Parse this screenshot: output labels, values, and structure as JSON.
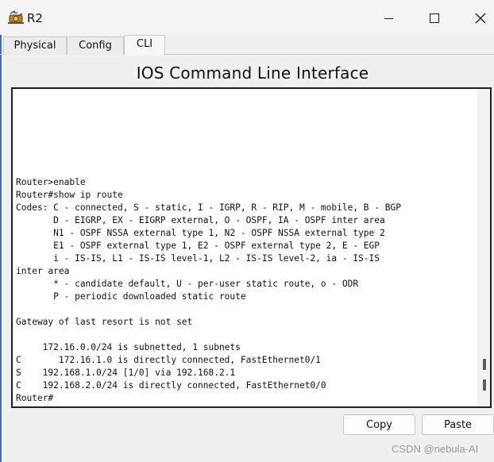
{
  "window": {
    "title": "R2",
    "icon": "router-icon"
  },
  "window_controls": {
    "minimize": "minimize-icon",
    "maximize": "maximize-icon",
    "close": "close-icon"
  },
  "tabs": [
    {
      "label": "Physical"
    },
    {
      "label": "Config"
    },
    {
      "label": "CLI"
    }
  ],
  "active_tab": "CLI",
  "heading": "IOS Command Line Interface",
  "terminal": {
    "lines": [
      "Router>enable",
      "Router#show ip route",
      "Codes: C - connected, S - static, I - IGRP, R - RIP, M - mobile, B - BGP",
      "       D - EIGRP, EX - EIGRP external, O - OSPF, IA - OSPF inter area",
      "       N1 - OSPF NSSA external type 1, N2 - OSPF NSSA external type 2",
      "       E1 - OSPF external type 1, E2 - OSPF external type 2, E - EGP",
      "       i - IS-IS, L1 - IS-IS level-1, L2 - IS-IS level-2, ia - IS-IS",
      "inter area",
      "       * - candidate default, U - per-user static route, o - ODR",
      "       P - periodic downloaded static route",
      "",
      "Gateway of last resort is not set",
      "",
      "     172.16.0.0/24 is subnetted, 1 subnets",
      "C       172.16.1.0 is directly connected, FastEthernet0/1",
      "S    192.168.1.0/24 [1/0] via 192.168.2.1",
      "C    192.168.2.0/24 is directly connected, FastEthernet0/0",
      "Router#"
    ]
  },
  "buttons": {
    "copy": "Copy",
    "paste": "Paste"
  },
  "watermark": "CSDN @nebula-AI",
  "colors": {
    "terminal_bg": "#ffffff",
    "window_bg": "#f0f0f0",
    "border": "#1f1f1f"
  }
}
